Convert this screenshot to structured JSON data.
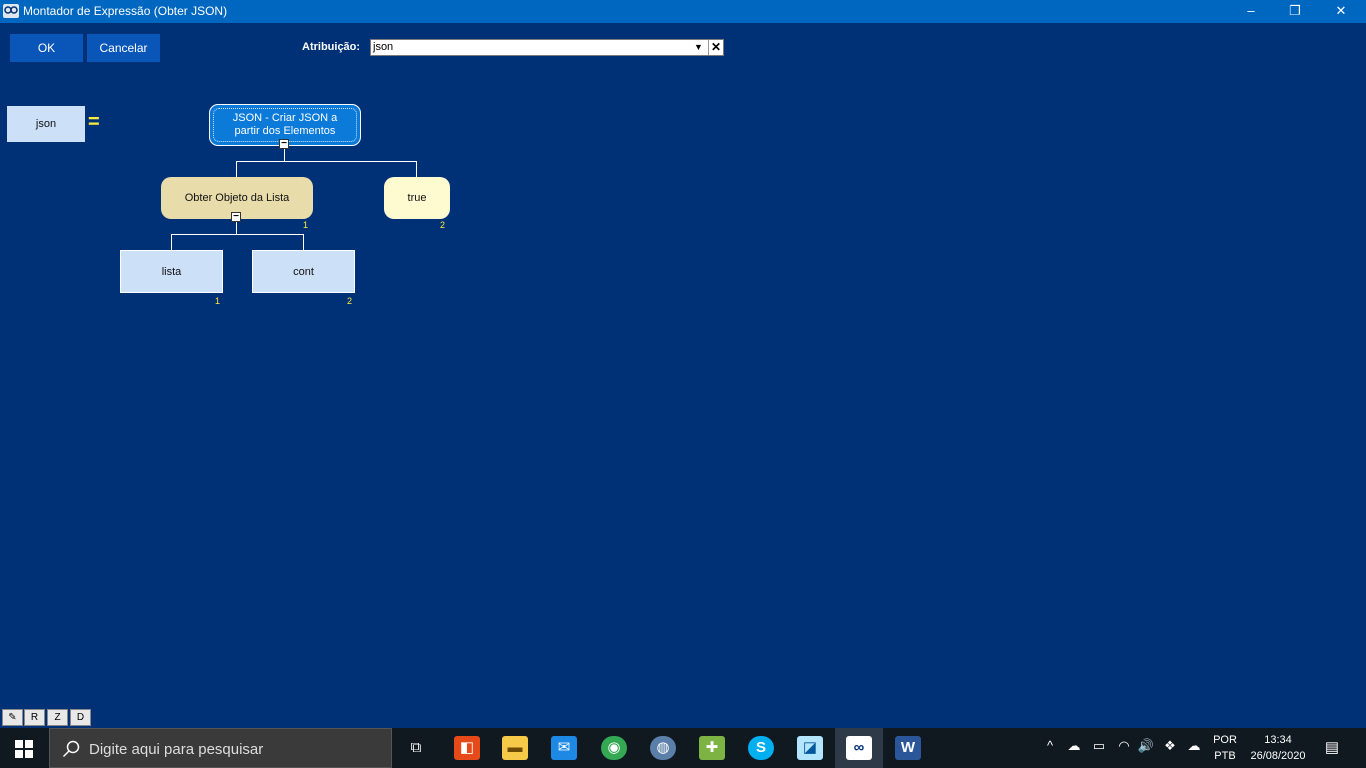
{
  "window": {
    "title": "Montador de Expressão (Obter JSON)",
    "minimize_icon": "–",
    "restore_icon": "❐",
    "close_icon": "✕"
  },
  "toolbar": {
    "ok_label": "OK",
    "cancel_label": "Cancelar",
    "attribution_label": "Atribuição:",
    "attribution_value": "json",
    "dropdown_icon": "▼",
    "clear_icon": "✕"
  },
  "expression": {
    "target": "json",
    "equals": "=",
    "root": {
      "label": "JSON - Criar JSON a partir dos Elementos",
      "children": [
        {
          "label": "Obter Objeto da Lista",
          "index": "1",
          "children": [
            {
              "label": "lista",
              "index": "1"
            },
            {
              "label": "cont",
              "index": "2"
            }
          ]
        },
        {
          "label": "true",
          "index": "2"
        }
      ]
    },
    "collapse_symbol": "−"
  },
  "bottom_buttons": [
    {
      "label": "✎",
      "icon": "edit-icon"
    },
    {
      "label": "R"
    },
    {
      "label": "Z"
    },
    {
      "label": "D"
    }
  ],
  "taskbar": {
    "start_icon": "windows-start-icon",
    "search_placeholder": "Digite aqui para pesquisar",
    "apps": [
      {
        "name": "task-view",
        "glyph": "⧉"
      },
      {
        "name": "office",
        "glyph": "◧",
        "color": "#e64a19"
      },
      {
        "name": "file-explorer",
        "glyph": "▬",
        "color": "#f7c948"
      },
      {
        "name": "mail",
        "glyph": "✉",
        "color": "#1e88e5"
      },
      {
        "name": "chrome",
        "glyph": "◉",
        "color": "#34a853"
      },
      {
        "name": "network-tool",
        "glyph": "◍",
        "color": "#90caf9"
      },
      {
        "name": "app-green",
        "glyph": "✚",
        "color": "#7cb342"
      },
      {
        "name": "skype",
        "glyph": "S",
        "color": "#00aff0"
      },
      {
        "name": "app-glass",
        "glyph": "◪",
        "color": "#b3e5fc"
      },
      {
        "name": "maker",
        "glyph": "∞",
        "color": "#ffffff"
      },
      {
        "name": "word",
        "glyph": "W",
        "color": "#2b579a"
      }
    ],
    "tray_icons": [
      "^",
      "☁",
      "▭",
      "◠",
      "🔊",
      "❖",
      "☁"
    ],
    "language_line1": "POR",
    "language_line2": "PTB",
    "time": "13:34",
    "date": "26/08/2020",
    "notification_icon": "▤"
  }
}
